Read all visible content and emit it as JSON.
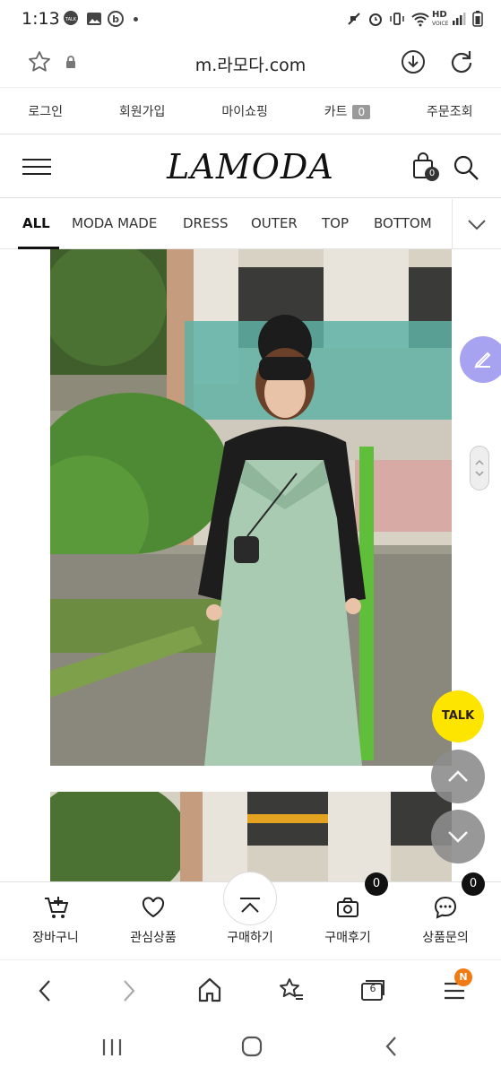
{
  "status_bar": {
    "time": "1:13",
    "icons": [
      "talk-icon",
      "gallery-icon",
      "b-app-icon",
      "mute-icon",
      "alarm-icon",
      "wifi-icon",
      "hd-voice-icon",
      "signal-icon",
      "battery-icon"
    ],
    "hd_label": "HD"
  },
  "browser": {
    "url": "m.라모다.com",
    "tab_count": "6",
    "menu_badge": "N"
  },
  "top_links": {
    "login": "로그인",
    "signup": "회원가입",
    "mypage": "마이쇼핑",
    "cart": "카트",
    "cart_count": "0",
    "orders": "주문조회"
  },
  "header": {
    "logo": "LAMODA",
    "bag_count": "0"
  },
  "categories": [
    "ALL",
    "MODA MADE",
    "DRESS",
    "OUTER",
    "TOP",
    "BOTTOM"
  ],
  "active_category": "ALL",
  "chat_button": {
    "label": "TALK"
  },
  "action_bar": {
    "cart_label": "장바구니",
    "wishlist_label": "관심상품",
    "buy_label": "구매하기",
    "review_label": "구매후기",
    "review_count": "0",
    "inquiry_label": "상품문의",
    "inquiry_count": "0"
  },
  "colors": {
    "talk_yellow": "#fde500",
    "edit_fab": "#a8a3f0",
    "menu_badge": "#f07a14",
    "dress_mint": "#a9cbb2"
  }
}
